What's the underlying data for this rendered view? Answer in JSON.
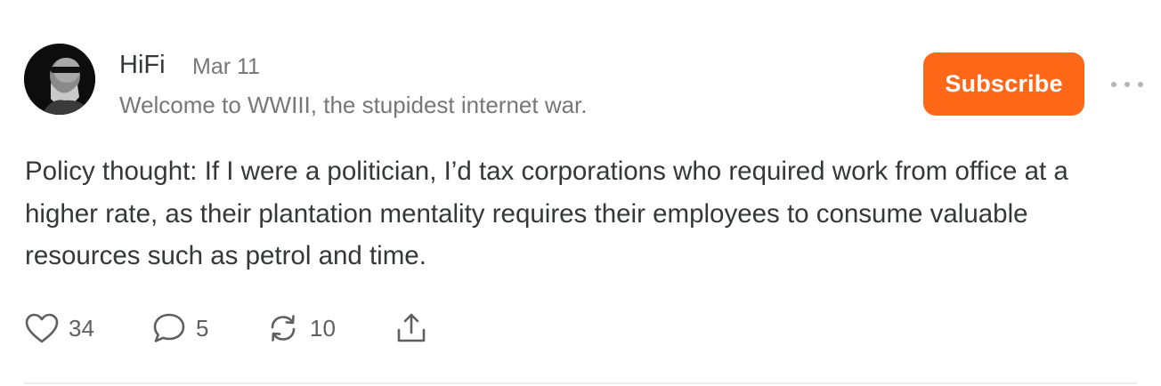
{
  "author": {
    "name": "HiFi",
    "bio": "Welcome to WWIII, the stupidest internet war."
  },
  "post": {
    "date": "Mar 11",
    "body": "Policy thought: If I were a politician, I’d tax corporations who required work from office at a higher rate, as their plantation mentality requires their employees to consume valuable resources such as petrol and time."
  },
  "buttons": {
    "subscribe_label": "Subscribe"
  },
  "actions": {
    "likes": "34",
    "comments": "5",
    "restacks": "10"
  },
  "colors": {
    "accent": "#ff6719",
    "text": "#363737",
    "muted": "#777777"
  },
  "icons": {
    "like": "heart-icon",
    "comment": "speech-bubble-icon",
    "restack": "restack-arrows-icon",
    "share": "share-upload-icon",
    "more": "ellipsis-icon"
  }
}
